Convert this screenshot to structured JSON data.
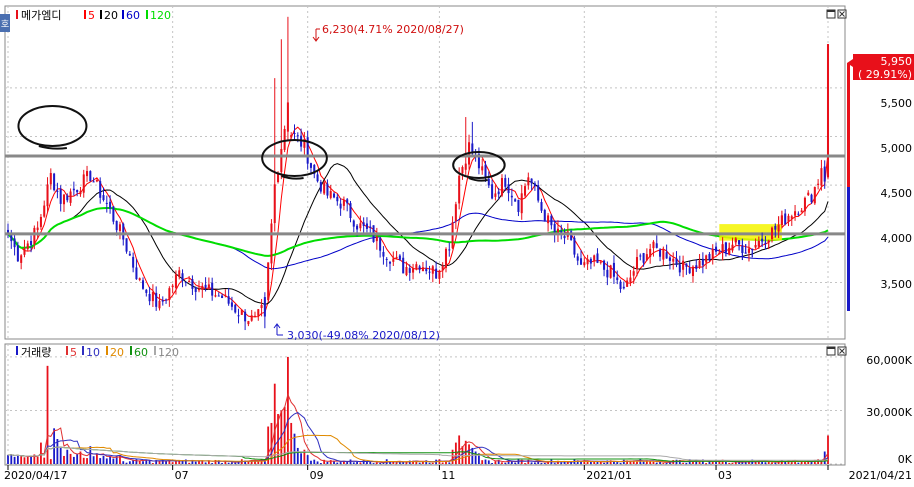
{
  "colors": {
    "up": "#e8101a",
    "down": "#1a1ac8",
    "ma5": "#ff0000",
    "ma20": "#000000",
    "ma60": "#0000c8",
    "ma120": "#00dd00",
    "vol_ma5": "#e03030",
    "vol_ma10": "#3030c0",
    "vol_ma20": "#e08a00",
    "vol_ma60": "#109010",
    "vol_ma120": "#aaaaaa",
    "grid": "#c4c4c4",
    "refline": "#888888",
    "highlight": "#f4f400"
  },
  "chart_data": [
    {
      "type": "candlestick",
      "title": "메가엠디",
      "legend": [
        {
          "label": "메가엠디",
          "color": "#e8101a"
        },
        {
          "label": "5",
          "color": "#ff0000"
        },
        {
          "label": "20",
          "color": "#000000"
        },
        {
          "label": "60",
          "color": "#0000c8"
        },
        {
          "label": "120",
          "color": "#00dd00"
        }
      ],
      "yticks": [
        "5,500",
        "5,000",
        "4,500",
        "4,000",
        "3,500"
      ],
      "ytick_values": [
        5500,
        5000,
        4500,
        4000,
        3500
      ],
      "ylim": [
        2950,
        6300
      ],
      "xticks": [
        "2020/04/17",
        "07",
        "09",
        "11",
        "2021/01",
        "03",
        "2021/04/21"
      ],
      "xtick_positions": [
        0,
        50,
        91,
        131,
        175,
        215,
        249
      ],
      "n_days": 250,
      "current_price": "5,950",
      "current_change": "( 29.91%)",
      "max_annotation": "6,230(4.71% 2020/08/27)",
      "min_annotation": "3,030(-49.08% 2020/08/12)",
      "max": {
        "date": "2020/08/27",
        "value": 6230
      },
      "min": {
        "date": "2020/08/12",
        "value": 3030
      },
      "reference_lines": [
        4800,
        4000
      ],
      "anchors": [
        {
          "i": 0,
          "c": 4000
        },
        {
          "i": 3,
          "c": 3780
        },
        {
          "i": 6,
          "c": 3900
        },
        {
          "i": 9,
          "c": 4050
        },
        {
          "i": 13,
          "c": 4600
        },
        {
          "i": 16,
          "c": 4350
        },
        {
          "i": 20,
          "c": 4450
        },
        {
          "i": 25,
          "c": 4600
        },
        {
          "i": 30,
          "c": 4300
        },
        {
          "i": 35,
          "c": 3950
        },
        {
          "i": 40,
          "c": 3500
        },
        {
          "i": 46,
          "c": 3250
        },
        {
          "i": 52,
          "c": 3600
        },
        {
          "i": 58,
          "c": 3450
        },
        {
          "i": 65,
          "c": 3350
        },
        {
          "i": 70,
          "c": 3200
        },
        {
          "i": 75,
          "c": 3100
        },
        {
          "i": 78,
          "c": 3250
        },
        {
          "i": 81,
          "c": 4500
        },
        {
          "i": 84,
          "c": 5100
        },
        {
          "i": 87,
          "c": 5000
        },
        {
          "i": 90,
          "c": 4900
        },
        {
          "i": 93,
          "c": 4600
        },
        {
          "i": 97,
          "c": 4400
        },
        {
          "i": 102,
          "c": 4300
        },
        {
          "i": 106,
          "c": 4100
        },
        {
          "i": 110,
          "c": 4000
        },
        {
          "i": 115,
          "c": 3800
        },
        {
          "i": 120,
          "c": 3650
        },
        {
          "i": 125,
          "c": 3700
        },
        {
          "i": 130,
          "c": 3600
        },
        {
          "i": 134,
          "c": 3900
        },
        {
          "i": 137,
          "c": 4600
        },
        {
          "i": 140,
          "c": 4900
        },
        {
          "i": 143,
          "c": 4700
        },
        {
          "i": 147,
          "c": 4400
        },
        {
          "i": 151,
          "c": 4550
        },
        {
          "i": 155,
          "c": 4300
        },
        {
          "i": 158,
          "c": 4600
        },
        {
          "i": 162,
          "c": 4250
        },
        {
          "i": 166,
          "c": 4000
        },
        {
          "i": 170,
          "c": 3950
        },
        {
          "i": 174,
          "c": 3650
        },
        {
          "i": 178,
          "c": 3700
        },
        {
          "i": 183,
          "c": 3600
        },
        {
          "i": 187,
          "c": 3400
        },
        {
          "i": 191,
          "c": 3700
        },
        {
          "i": 195,
          "c": 3850
        },
        {
          "i": 200,
          "c": 3800
        },
        {
          "i": 205,
          "c": 3650
        },
        {
          "i": 210,
          "c": 3700
        },
        {
          "i": 215,
          "c": 3800
        },
        {
          "i": 220,
          "c": 3900
        },
        {
          "i": 225,
          "c": 3850
        },
        {
          "i": 229,
          "c": 3950
        },
        {
          "i": 233,
          "c": 4050
        },
        {
          "i": 237,
          "c": 4200
        },
        {
          "i": 241,
          "c": 4300
        },
        {
          "i": 244,
          "c": 4400
        },
        {
          "i": 246,
          "c": 4550
        },
        {
          "i": 247,
          "c": 4700
        },
        {
          "i": 248,
          "c": 4580
        },
        {
          "i": 249,
          "c": 5950
        }
      ]
    },
    {
      "type": "bar",
      "title": "거래량",
      "legend": [
        {
          "label": "거래량",
          "color": "#1a1ac8"
        },
        {
          "label": "5",
          "color": "#e03030"
        },
        {
          "label": "10",
          "color": "#3030c0"
        },
        {
          "label": "20",
          "color": "#e08a00"
        },
        {
          "label": "60",
          "color": "#109010"
        },
        {
          "label": "120",
          "color": "#aaaaaa"
        }
      ],
      "yticks": [
        "60,000K",
        "30,000K",
        "0K"
      ],
      "ytick_values": [
        60000,
        30000,
        0
      ],
      "ylim": [
        0,
        65000
      ],
      "unit": "K",
      "spikes": [
        {
          "i": 10,
          "v": 12000
        },
        {
          "i": 12,
          "v": 55000
        },
        {
          "i": 14,
          "v": 20000
        },
        {
          "i": 15,
          "v": 14000
        },
        {
          "i": 16,
          "v": 9000
        },
        {
          "i": 18,
          "v": 8000
        },
        {
          "i": 22,
          "v": 7000
        },
        {
          "i": 25,
          "v": 10000
        },
        {
          "i": 27,
          "v": 6000
        },
        {
          "i": 79,
          "v": 21000
        },
        {
          "i": 80,
          "v": 23000
        },
        {
          "i": 81,
          "v": 45000
        },
        {
          "i": 82,
          "v": 28000
        },
        {
          "i": 83,
          "v": 30000
        },
        {
          "i": 84,
          "v": 32000
        },
        {
          "i": 85,
          "v": 60000
        },
        {
          "i": 86,
          "v": 23000
        },
        {
          "i": 87,
          "v": 17000
        },
        {
          "i": 88,
          "v": 9000
        },
        {
          "i": 89,
          "v": 6000
        },
        {
          "i": 90,
          "v": 8000
        },
        {
          "i": 91,
          "v": 5000
        },
        {
          "i": 135,
          "v": 8000
        },
        {
          "i": 136,
          "v": 12000
        },
        {
          "i": 137,
          "v": 16000
        },
        {
          "i": 138,
          "v": 10000
        },
        {
          "i": 139,
          "v": 13000
        },
        {
          "i": 140,
          "v": 11000
        },
        {
          "i": 141,
          "v": 9000
        },
        {
          "i": 142,
          "v": 7000
        },
        {
          "i": 143,
          "v": 6000
        },
        {
          "i": 248,
          "v": 7000
        },
        {
          "i": 249,
          "v": 16000
        }
      ]
    }
  ]
}
